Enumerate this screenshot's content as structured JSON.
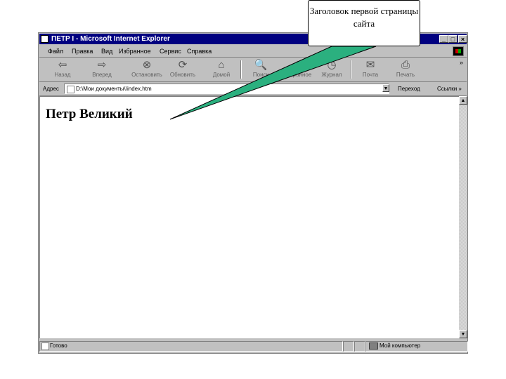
{
  "window": {
    "title": "ПЕТР I - Microsoft Internet Explorer",
    "controls": [
      "_",
      "□",
      "×"
    ]
  },
  "menu": [
    "Файл",
    "Правка",
    "Вид",
    "Избранное",
    "Сервис",
    "Справка"
  ],
  "toolbar": [
    {
      "label": "Назад",
      "icon": "back-arrow-icon",
      "glyph": "⇦"
    },
    {
      "label": "Вперед",
      "icon": "forward-arrow-icon",
      "glyph": "⇨"
    },
    {
      "label": "Остановить",
      "icon": "stop-icon",
      "glyph": "⊗"
    },
    {
      "label": "Обновить",
      "icon": "refresh-icon",
      "glyph": "⟳"
    },
    {
      "label": "Домой",
      "icon": "home-icon",
      "glyph": "⌂"
    },
    {
      "label": "Поиск",
      "icon": "search-icon",
      "glyph": "🔍"
    },
    {
      "label": "Избранное",
      "icon": "favorites-icon",
      "glyph": "★"
    },
    {
      "label": "Журнал",
      "icon": "history-icon",
      "glyph": "◷"
    },
    {
      "label": "Почта",
      "icon": "mail-icon",
      "glyph": "✉"
    },
    {
      "label": "Печать",
      "icon": "print-icon",
      "glyph": "⎙"
    }
  ],
  "address": {
    "label": "Адрес",
    "value": "D:\\Мои документы\\\\index.htm",
    "go_label": "Переход",
    "links_label": "Ссылки »"
  },
  "page": {
    "heading": "Петр Великий"
  },
  "status": {
    "left": "Готово",
    "zone": "Мой компьютер"
  },
  "callout": {
    "text": "Заголовок первой страницы сайта",
    "fill": "#2bb07f"
  }
}
